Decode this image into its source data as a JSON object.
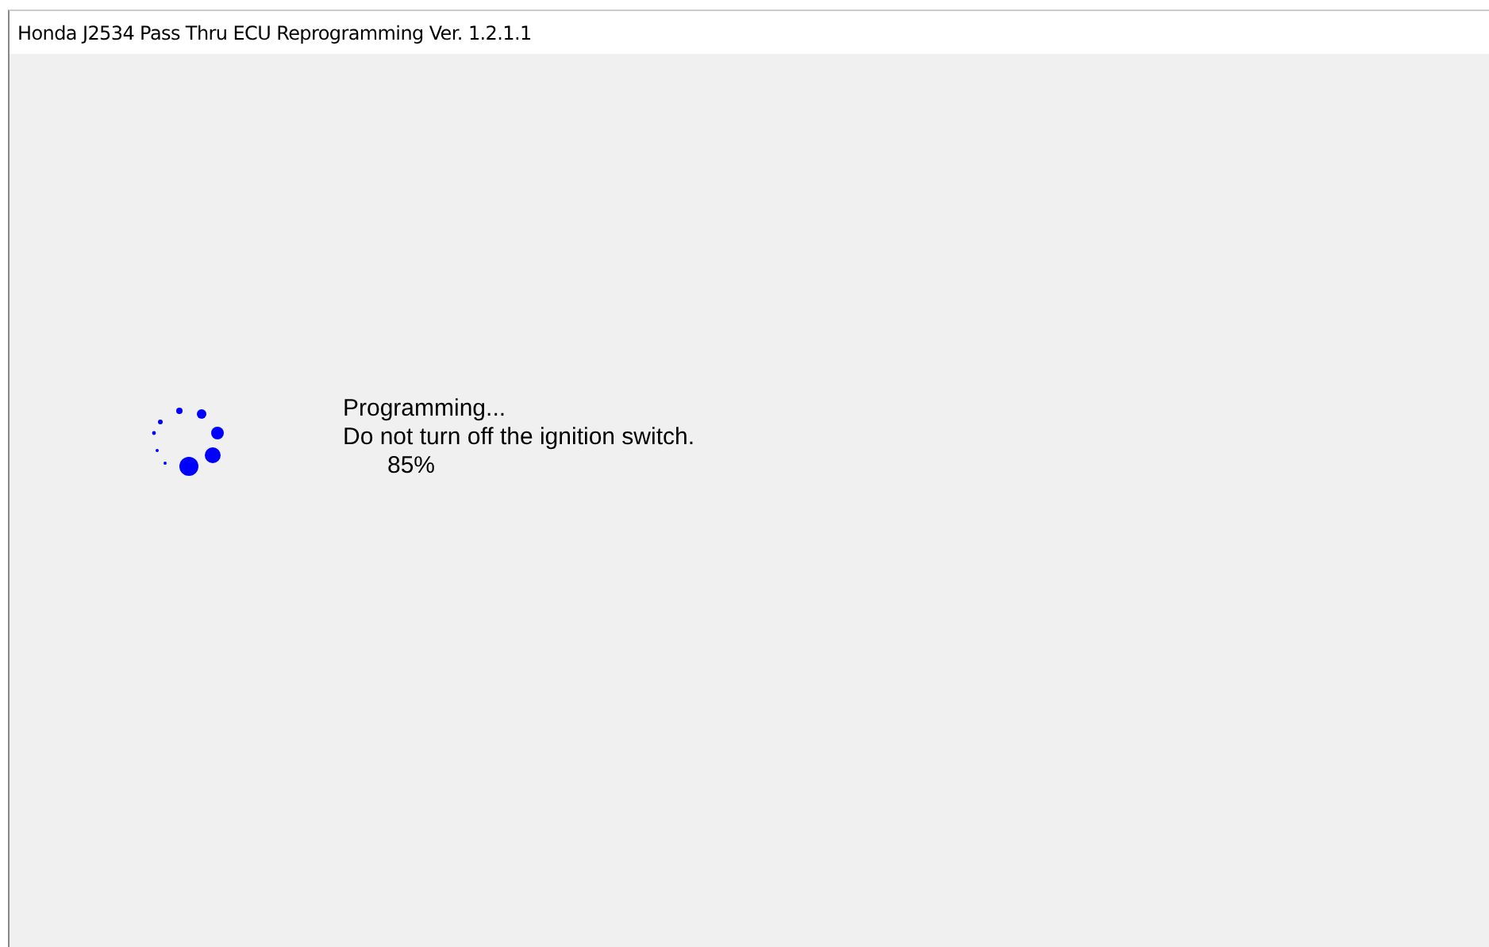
{
  "window": {
    "title": "Honda J2534 Pass Thru ECU Reprogramming Ver. 1.2.1.1"
  },
  "status": {
    "heading": "Programming...",
    "warning": "Do not turn off the ignition switch.",
    "percent": "85%"
  }
}
